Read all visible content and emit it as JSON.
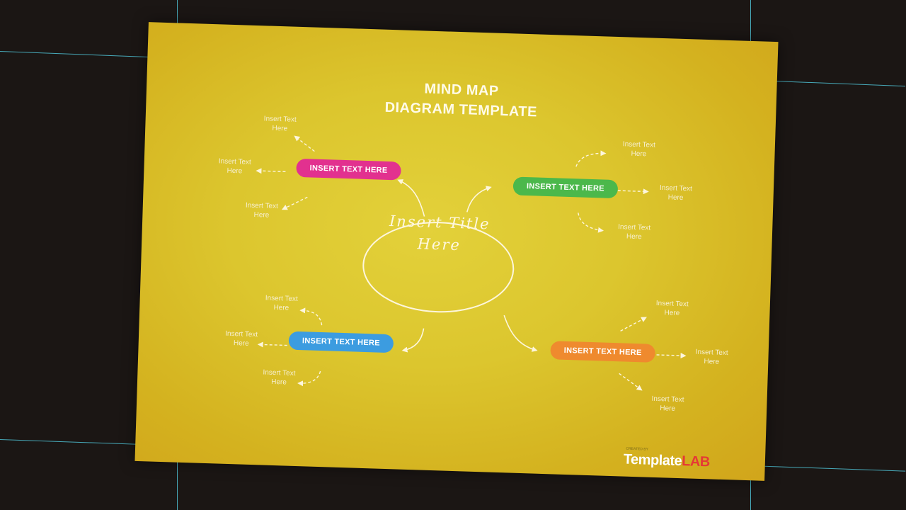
{
  "title": {
    "line1": "MIND MAP",
    "line2": "DIAGRAM TEMPLATE"
  },
  "center": {
    "line1": "Insert Title",
    "line2": "Here"
  },
  "branches": {
    "top_left": {
      "label": "INSERT TEXT HERE",
      "color": "#e2318f"
    },
    "top_right": {
      "label": "INSERT TEXT HERE",
      "color": "#4bb84b"
    },
    "bottom_left": {
      "label": "INSERT TEXT HERE",
      "color": "#3c9ce0"
    },
    "bottom_right": {
      "label": "INSERT TEXT HERE",
      "color": "#ef8a2e"
    }
  },
  "leaf_text": {
    "line1": "Insert Text",
    "line2": "Here"
  },
  "logo": {
    "part1": "Template",
    "part2": "LAB",
    "small": "CREATED BY"
  },
  "colors": {
    "background": "#1b1614",
    "slide": "#dcc62e",
    "guides": "#4fc3d6"
  }
}
